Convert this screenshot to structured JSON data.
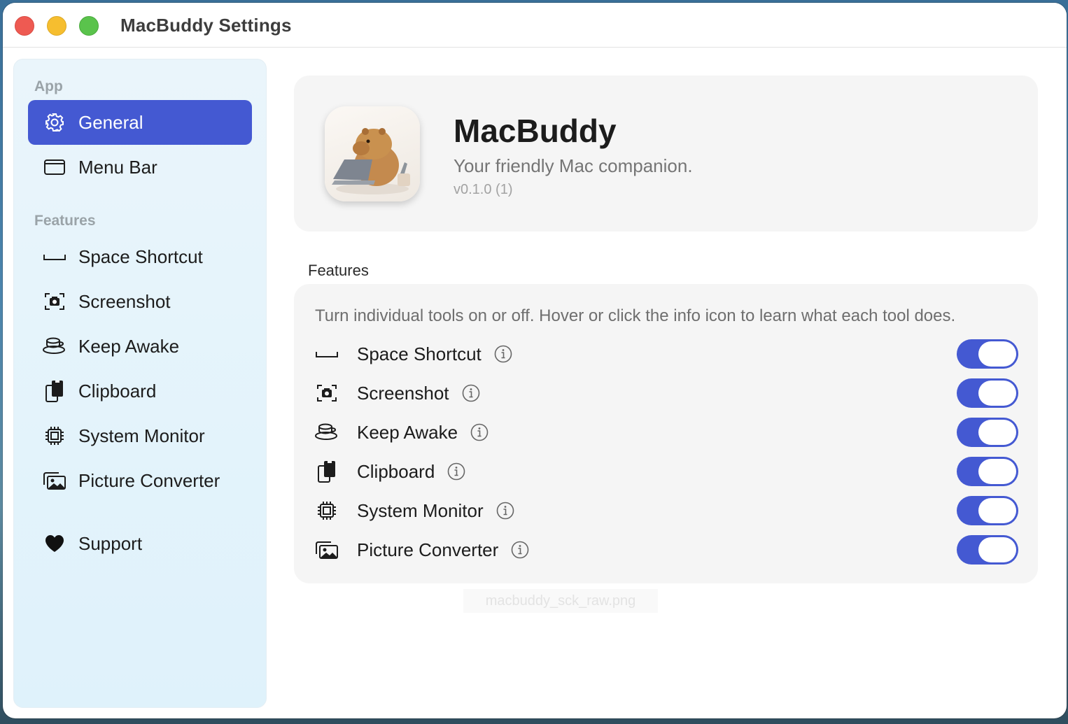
{
  "window": {
    "title": "MacBuddy Settings"
  },
  "sidebar": {
    "section_app": "App",
    "section_features": "Features",
    "items": [
      {
        "label": "General",
        "icon": "gear-icon",
        "active": true
      },
      {
        "label": "Menu Bar",
        "icon": "window-icon",
        "active": false
      },
      {
        "label": "Space Shortcut",
        "icon": "space-key-icon",
        "active": false
      },
      {
        "label": "Screenshot",
        "icon": "camera-viewfinder-icon",
        "active": false
      },
      {
        "label": "Keep Awake",
        "icon": "cup-icon",
        "active": false
      },
      {
        "label": "Clipboard",
        "icon": "clipboard-icon",
        "active": false
      },
      {
        "label": "System Monitor",
        "icon": "cpu-icon",
        "active": false
      },
      {
        "label": "Picture Converter",
        "icon": "photos-icon",
        "active": false
      },
      {
        "label": "Support",
        "icon": "heart-icon",
        "active": false
      }
    ]
  },
  "hero": {
    "name": "MacBuddy",
    "tagline": "Your friendly Mac companion.",
    "version": "v0.1.0 (1)"
  },
  "features": {
    "heading": "Features",
    "description": "Turn individual tools on or off. Hover or click the info icon to learn what each tool does.",
    "rows": [
      {
        "label": "Space Shortcut",
        "icon": "space-key-icon",
        "enabled": true
      },
      {
        "label": "Screenshot",
        "icon": "camera-viewfinder-icon",
        "enabled": true
      },
      {
        "label": "Keep Awake",
        "icon": "cup-icon",
        "enabled": true
      },
      {
        "label": "Clipboard",
        "icon": "clipboard-icon",
        "enabled": true
      },
      {
        "label": "System Monitor",
        "icon": "cpu-icon",
        "enabled": true
      },
      {
        "label": "Picture Converter",
        "icon": "photos-icon",
        "enabled": true
      }
    ]
  },
  "watermark": "macbuddy_sck_raw.png",
  "colors": {
    "accent": "#4459d2",
    "sidebar_bg": "#e3f3fb",
    "card_bg": "#f5f5f5"
  }
}
